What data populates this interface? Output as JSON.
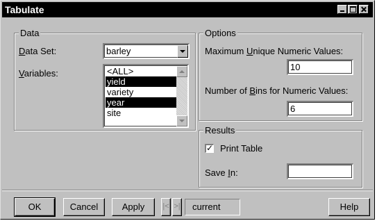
{
  "window": {
    "title": "Tabulate"
  },
  "data_group": {
    "legend": "Data",
    "dataset_label_u": "D",
    "dataset_label_rest": "ata Set:",
    "dataset_value": "barley",
    "variables_label_u": "V",
    "variables_label_rest": "ariables:",
    "variables": [
      {
        "label": "<ALL>",
        "selected": false
      },
      {
        "label": "yield",
        "selected": true
      },
      {
        "label": "variety",
        "selected": false
      },
      {
        "label": "year",
        "selected": true
      },
      {
        "label": "site",
        "selected": false
      }
    ]
  },
  "options_group": {
    "legend": "Options",
    "max_unique_pre": "Maximum ",
    "max_unique_u": "U",
    "max_unique_post": "nique Numeric Values:",
    "max_unique_value": "10",
    "bins_pre": "Number of ",
    "bins_u": "B",
    "bins_post": "ins for Numeric Values:",
    "bins_value": "6"
  },
  "results_group": {
    "legend": "Results",
    "print_table_label": "Print Table",
    "print_table_checked": true,
    "checkmark": "✓",
    "save_in_pre": "Save ",
    "save_in_u": "I",
    "save_in_post": "n:",
    "save_in_value": ""
  },
  "buttons": {
    "ok": "OK",
    "cancel": "Cancel",
    "apply": "Apply",
    "prev": "|<",
    "next": ">|",
    "current": "current",
    "help": "Help"
  }
}
